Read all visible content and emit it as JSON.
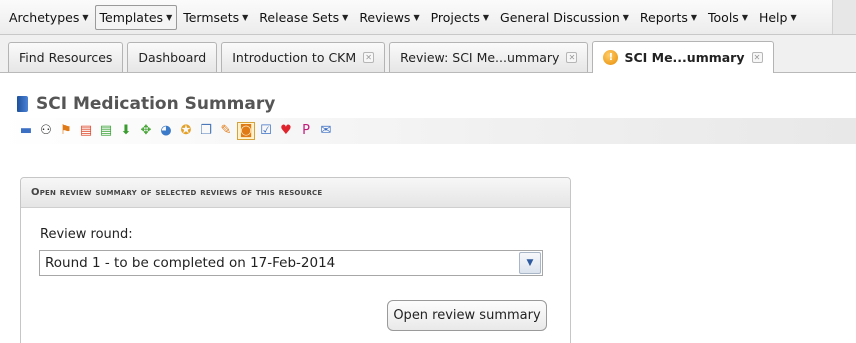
{
  "menu": {
    "items": [
      {
        "label": "Archetypes"
      },
      {
        "label": "Templates"
      },
      {
        "label": "Termsets"
      },
      {
        "label": "Release Sets"
      },
      {
        "label": "Reviews"
      },
      {
        "label": "Projects"
      },
      {
        "label": "General Discussion"
      },
      {
        "label": "Reports"
      },
      {
        "label": "Tools"
      },
      {
        "label": "Help"
      }
    ],
    "caret": "▼",
    "active_index": 1
  },
  "tabs": [
    {
      "label": "Find Resources",
      "closable": false
    },
    {
      "label": "Dashboard",
      "closable": false
    },
    {
      "label": "Introduction to CKM",
      "closable": true
    },
    {
      "label": "Review: SCI Me...ummary",
      "closable": true
    },
    {
      "label": "SCI Me...ummary",
      "closable": true,
      "active": true,
      "icon": "warning-icon",
      "icon_glyph": "!"
    }
  ],
  "tab_close_glyph": "✕",
  "resource": {
    "title": "SCI Medication Summary"
  },
  "toolbar_icons": [
    {
      "name": "overview-icon",
      "glyph": "▬",
      "color": "#3a6fc4"
    },
    {
      "name": "mindmap-icon",
      "glyph": "⚇",
      "color": "#333333"
    },
    {
      "name": "hierarchy-icon",
      "glyph": "⚑",
      "color": "#e07a16"
    },
    {
      "name": "oet-icon",
      "glyph": "▤",
      "color": "#e2492b"
    },
    {
      "name": "opt-icon",
      "glyph": "▤",
      "color": "#3da53a"
    },
    {
      "name": "download-icon",
      "glyph": "⬇",
      "color": "#3a9b2e"
    },
    {
      "name": "relations-icon",
      "glyph": "✥",
      "color": "#4aa63a"
    },
    {
      "name": "pie-chart-icon",
      "glyph": "◕",
      "color": "#3b7ac8"
    },
    {
      "name": "award-icon",
      "glyph": "✪",
      "color": "#e3a12a"
    },
    {
      "name": "book-open-icon",
      "glyph": "❐",
      "color": "#4a78b8"
    },
    {
      "name": "discussion-icon",
      "glyph": "✎",
      "color": "#e07a16"
    },
    {
      "name": "review-icon",
      "glyph": "◙",
      "color": "#e07a16",
      "selected": true
    },
    {
      "name": "edit-icon",
      "glyph": "☑",
      "color": "#3a6fc4"
    },
    {
      "name": "heart-icon",
      "glyph": "♥",
      "color": "#e0242d"
    },
    {
      "name": "p-icon",
      "glyph": "P",
      "color": "#c01c7a"
    },
    {
      "name": "mail-icon",
      "glyph": "✉",
      "color": "#3a6fc4"
    }
  ],
  "panel": {
    "header": "Open review summary of selected reviews of this resource",
    "review_round_label": "Review round:",
    "review_round_value": "Round 1 - to be completed on 17-Feb-2014",
    "dropdown_glyph": "▼",
    "open_button_label": "Open review summary"
  }
}
